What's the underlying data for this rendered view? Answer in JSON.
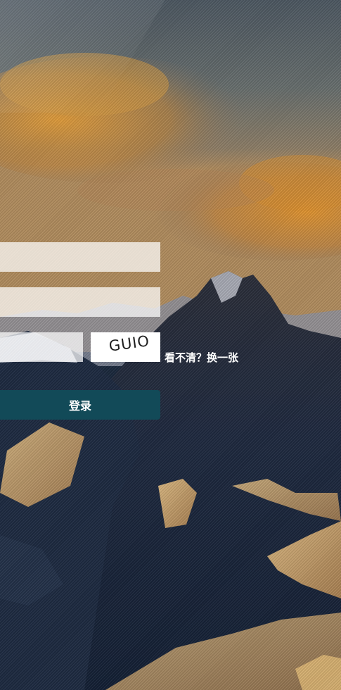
{
  "login_form": {
    "username": {
      "value": "",
      "placeholder": ""
    },
    "password": {
      "value": "",
      "placeholder": ""
    },
    "captcha": {
      "value": "",
      "placeholder": "",
      "image_text": "GUIO",
      "refresh_label": "看不清？换一张"
    },
    "submit_label": "登录"
  },
  "colors": {
    "button_bg": "#124a58",
    "sky_top": "#59616b",
    "cloud": "#d9973a"
  }
}
